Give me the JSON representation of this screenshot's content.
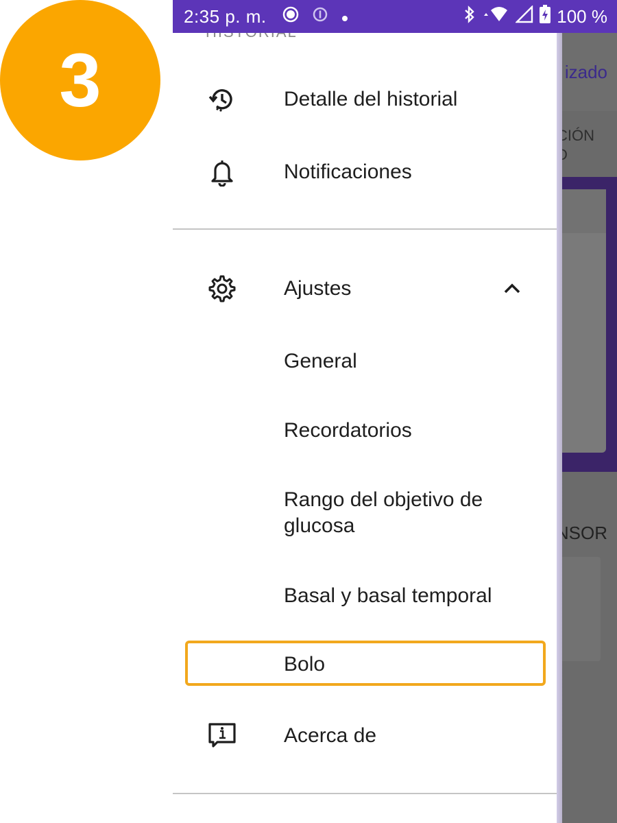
{
  "step_badge": {
    "number": "3",
    "color": "#FBA600"
  },
  "status_bar": {
    "time": "2:35 p. m.",
    "battery": "100 %",
    "icons": [
      "screen-record-icon",
      "info-circle-icon",
      "dot-icon",
      "bluetooth-icon",
      "wifi-icon",
      "signal-icon",
      "battery-charging-icon"
    ],
    "color": "#5C35B8"
  },
  "drawer": {
    "section_header": "HISTORIAL",
    "items": [
      {
        "label": "Detalle del historial",
        "icon": "history-icon"
      },
      {
        "label": "Notificaciones",
        "icon": "bell-icon"
      }
    ],
    "settings": {
      "label": "Ajustes",
      "icon": "gear-icon",
      "expanded_icon": "chevron-up-icon",
      "children": [
        {
          "label": "General"
        },
        {
          "label": "Recordatorios"
        },
        {
          "label": "Rango del objetivo de glucosa"
        },
        {
          "label": "Basal y basal temporal"
        },
        {
          "label": "Bolo",
          "highlighted": true
        }
      ]
    },
    "about": {
      "label": "Acerca de",
      "icon": "info-message-icon"
    }
  },
  "background_app": {
    "title_fragment": "izado",
    "tab_fragment_line1": "CIÓN",
    "tab_fragment_line2": "D",
    "sensor_fragment": "NSOR"
  },
  "highlight_color": "#F2A81D"
}
